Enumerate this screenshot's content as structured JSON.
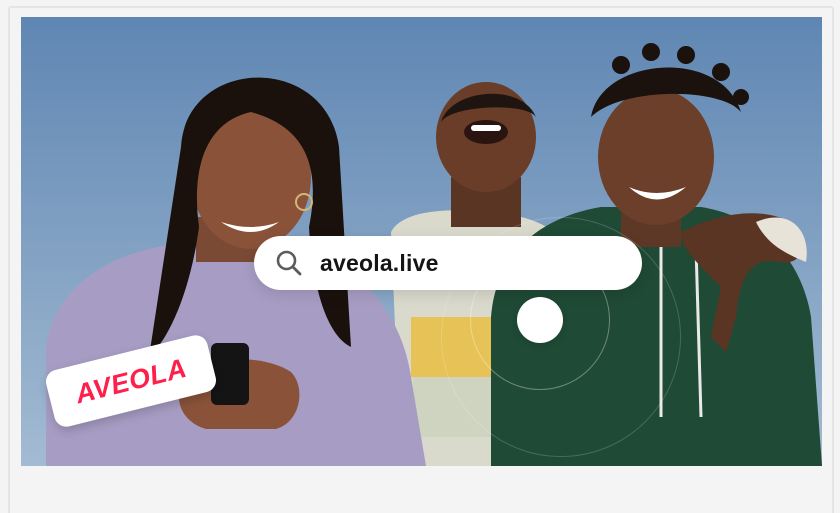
{
  "hero": {
    "image_alt": "Three friends laughing outdoors against a blue sky, one looking at a phone",
    "search_bar": {
      "value": "aveola.live",
      "icon": "search-icon"
    },
    "logo_badge": {
      "text": "AVEOLA",
      "color": "#ff1f4b"
    }
  },
  "colors": {
    "sky": "#7f9ebf",
    "page_background": "#f4f4f4",
    "hoodie_green": "#1f4a36",
    "sweater_lilac": "#a79dc4",
    "sweater_yellow": "#e6c257"
  }
}
